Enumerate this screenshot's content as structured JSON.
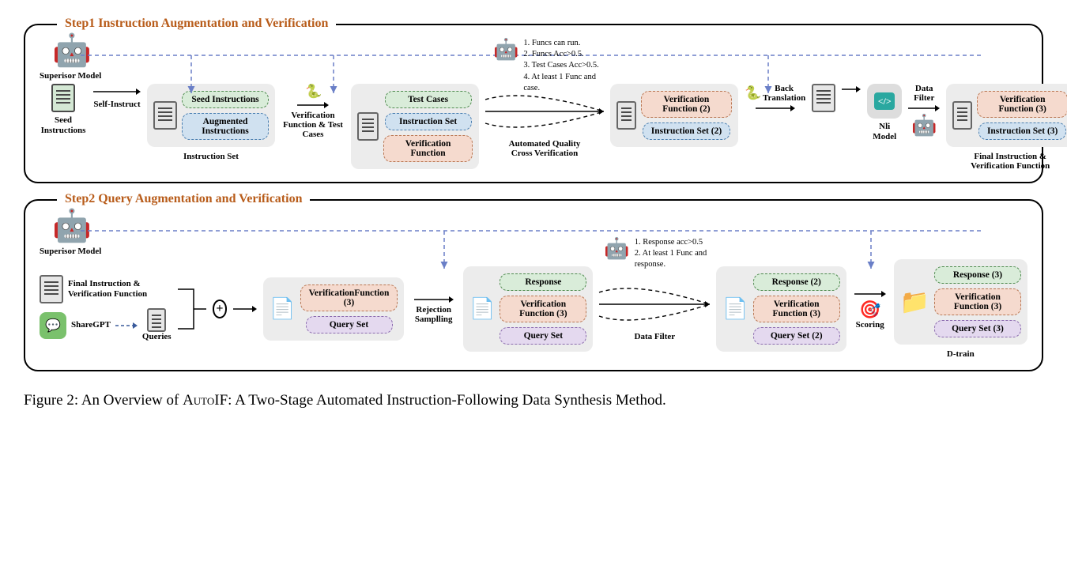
{
  "step1": {
    "title": "Step1 Instruction Augmentation and Verification",
    "superior_model": "Superisor Model",
    "seed_instructions": "Seed Instructions",
    "self_instruct": "Self-Instruct",
    "instruction_set": "Instruction Set",
    "seed_instr_pill": "Seed Instructions",
    "aug_instr_pill": "Augmented Instructions",
    "vf_tc_label": "Verification Function & Test Cases",
    "test_cases": "Test Cases",
    "instruction_set_pill": "Instruction Set",
    "verification_function": "Verification Function",
    "criteria": {
      "c1": "1. Funcs can run.",
      "c2": "2. Funcs Acc>0.5.",
      "c3": "3. Test Cases Acc>0.5.",
      "c4": "4. At least 1 Func and case."
    },
    "auto_quality": "Automated Quality Cross Verification",
    "vf2": "Verification Function (2)",
    "is2": "Instruction Set (2)",
    "back_translation": "Back Translation",
    "nli_model": "Nli Model",
    "data_filter": "Data Filter",
    "vf3": "Verification Function (3)",
    "is3": "Instruction Set (3)",
    "final_label": "Final Instruction & Verification Function"
  },
  "step2": {
    "title": "Step2  Query Augmentation and Verification",
    "superior_model": "Superisor Model",
    "final_ivf": "Final Instruction & Verification Function",
    "sharegpt": "ShareGPT",
    "queries": "Queries",
    "vf3": "VerificationFunction (3)",
    "query_set": "Query Set",
    "rejection_sampling": "Rejection Samplling",
    "response": "Response",
    "verification_fn3": "Verification Function (3)",
    "criteria": {
      "c1": "1. Response acc>0.5",
      "c2": "2. At least 1 Func and response."
    },
    "data_filter": "Data Filter",
    "response2": "Response (2)",
    "qs2": "Query Set (2)",
    "scoring": "Scoring",
    "response3": "Response (3)",
    "qs3": "Query Set (3)",
    "dtrain": "D-train"
  },
  "caption": {
    "prefix": "Figure 2: An Overview of ",
    "name": "AutoIF",
    "suffix": ": A Two-Stage Automated Instruction-Following Data Synthesis Method."
  }
}
